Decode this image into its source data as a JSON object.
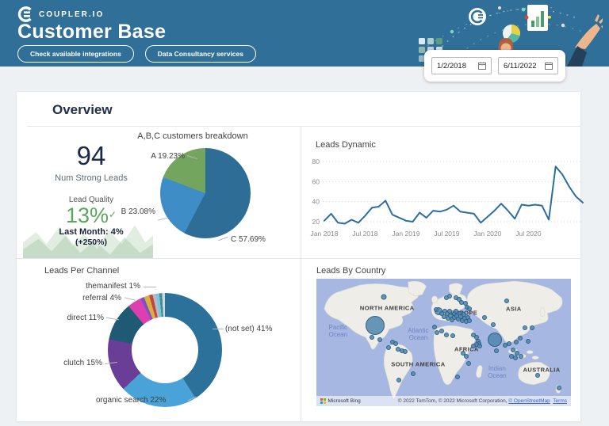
{
  "header": {
    "logo_text": "COUPLER.IO",
    "title": "Customer Base",
    "buttons": [
      {
        "label": "Check available integrations"
      },
      {
        "label": "Data Consultancy services"
      }
    ]
  },
  "date_range": {
    "start": "1/2/2018",
    "end": "6/11/2022"
  },
  "overview": {
    "title": "Overview"
  },
  "kpi": {
    "value": "94",
    "label": "Num Strong Leads",
    "quality_label": "Lead Quality",
    "quality_value": "13%",
    "check": "✓",
    "last_month": "Last Month: 4%",
    "change": "(+250%)"
  },
  "chart_data": [
    {
      "type": "pie",
      "title": "A,B,C customers breakdown",
      "slices": [
        {
          "label": "C",
          "value": 57.69,
          "display": "C 57.69%",
          "color": "#2e6e96"
        },
        {
          "label": "B",
          "value": 23.08,
          "display": "B 23.08%",
          "color": "#3f8dc6"
        },
        {
          "label": "A",
          "value": 19.23,
          "display": "A 19.23%",
          "color": "#73a55f"
        }
      ]
    },
    {
      "type": "line",
      "title": "Leads Dynamic",
      "series_name": "Leads",
      "x_start": "Jan 2018",
      "x_interval": "month",
      "values": [
        21,
        28,
        19,
        18,
        22,
        19,
        26,
        34,
        35,
        41,
        27,
        24,
        21,
        20,
        29,
        24,
        31,
        30,
        32,
        36,
        30,
        29,
        28,
        19,
        25,
        31,
        38,
        31,
        23,
        37,
        36,
        37,
        36,
        22,
        75,
        67,
        55,
        45,
        39
      ],
      "x_ticks": [
        {
          "label": "Jan 2018",
          "index": 0
        },
        {
          "label": "Jul 2018",
          "index": 6
        },
        {
          "label": "Jan 2019",
          "index": 12
        },
        {
          "label": "Jul 2019",
          "index": 18
        },
        {
          "label": "Jan 2020",
          "index": 24
        },
        {
          "label": "Jul 2020",
          "index": 30
        }
      ],
      "y_ticks": [
        20,
        40,
        60,
        80
      ],
      "ylim": [
        15,
        85
      ],
      "line_color": "#2b6f9e",
      "grid": "dotted"
    },
    {
      "type": "donut",
      "title": "Leads Per Channel",
      "slices": [
        {
          "label": "(not set)",
          "value": 41,
          "display": "(not set) 41%",
          "color": "#2b7199"
        },
        {
          "label": "organic search",
          "value": 22,
          "display": "organic search 22%",
          "color": "#4aa3d8"
        },
        {
          "label": "clutch",
          "value": 15,
          "display": "clutch 15%",
          "color": "#6a3d96"
        },
        {
          "label": "direct",
          "value": 11,
          "display": "direct 11%",
          "color": "#1f5a75"
        },
        {
          "label": "referral",
          "value": 4,
          "display": "referral 4%",
          "color": "#dd3fb0"
        },
        {
          "label": "themanifest",
          "value": 1,
          "display": "themanifest 1%",
          "color": "#7a52c9"
        },
        {
          "label": "",
          "value": 1.5,
          "display": "",
          "color": "#d8b13c"
        },
        {
          "label": "",
          "value": 1,
          "display": "",
          "color": "#c44343"
        },
        {
          "label": "",
          "value": 1,
          "display": "",
          "color": "#b3bcc3"
        },
        {
          "label": "",
          "value": 0.9,
          "display": "",
          "color": "#7fc4de"
        },
        {
          "label": "",
          "value": 0.8,
          "display": "",
          "color": "#3f8f93"
        },
        {
          "label": "",
          "value": 0.8,
          "display": "",
          "color": "#cdd9de"
        }
      ]
    },
    {
      "type": "map",
      "title": "Leads By Country",
      "regions": [
        {
          "t": "NORTH AMERICA",
          "x": 27.8,
          "y": 23
        },
        {
          "t": "EUROPE",
          "x": 58,
          "y": 26.5
        },
        {
          "t": "ASIA",
          "x": 77.5,
          "y": 23.5
        },
        {
          "t": "SOUTH AMERICA",
          "x": 40,
          "y": 67
        },
        {
          "t": "AFRICA",
          "x": 59,
          "y": 55
        },
        {
          "t": "AUSTRALIA",
          "x": 88.5,
          "y": 71.5
        }
      ],
      "oceans": [
        {
          "t": "Pacific\nOcean",
          "x": 8.5,
          "y": 41
        },
        {
          "t": "Atlantic\nOcean",
          "x": 40,
          "y": 43.5
        },
        {
          "t": "Indian\nOcean",
          "x": 71,
          "y": 73
        }
      ],
      "points": [
        [
          22.9,
          36.8,
          12
        ],
        [
          26.6,
          14.3,
          3.5
        ],
        [
          21.9,
          45.9,
          3
        ],
        [
          25,
          48,
          3
        ],
        [
          29.9,
          49.5,
          3
        ],
        [
          31.1,
          50.9,
          3
        ],
        [
          32.1,
          55.2,
          3
        ],
        [
          33.5,
          56.4,
          3
        ],
        [
          34.8,
          57.3,
          3
        ],
        [
          28.5,
          54.3,
          3
        ],
        [
          37.9,
          74.3,
          3
        ],
        [
          32.4,
          79.6,
          3
        ],
        [
          51,
          14.7,
          3
        ],
        [
          52.4,
          13.9,
          3
        ],
        [
          54.9,
          14.7,
          3
        ],
        [
          56.1,
          16,
          3
        ],
        [
          57.1,
          18.5,
          3
        ],
        [
          58.6,
          19.4,
          3
        ],
        [
          59.2,
          22.3,
          3
        ],
        [
          60.2,
          23.6,
          3
        ],
        [
          48.1,
          25.7,
          5
        ],
        [
          46.9,
          24.4,
          3
        ],
        [
          49.3,
          27.4,
          3
        ],
        [
          50.6,
          25.3,
          3
        ],
        [
          50.1,
          29.9,
          3
        ],
        [
          51.4,
          27.4,
          3
        ],
        [
          51.6,
          31.2,
          3
        ],
        [
          52.4,
          25.7,
          3
        ],
        [
          52.6,
          29.5,
          3
        ],
        [
          53.2,
          32.4,
          3
        ],
        [
          54.1,
          27.4,
          3
        ],
        [
          54.3,
          30.7,
          3
        ],
        [
          54.9,
          25.3,
          3
        ],
        [
          55.1,
          29.1,
          3
        ],
        [
          55.7,
          31.6,
          3
        ],
        [
          56.3,
          27.4,
          3
        ],
        [
          56.7,
          29.9,
          3
        ],
        [
          57.3,
          32.8,
          3
        ],
        [
          57.9,
          28.2,
          3
        ],
        [
          58.3,
          31.2,
          3
        ],
        [
          59,
          33.7,
          3
        ],
        [
          59.6,
          30.7,
          3
        ],
        [
          60.2,
          32.8,
          3
        ],
        [
          46.5,
          37.9,
          3
        ],
        [
          47.3,
          42.5,
          3
        ],
        [
          49.1,
          41.3,
          3
        ],
        [
          51,
          43.8,
          3
        ],
        [
          53.5,
          44.6,
          3
        ],
        [
          61.8,
          43.8,
          3
        ],
        [
          62.8,
          45.9,
          3
        ],
        [
          63.4,
          48.8,
          3
        ],
        [
          63.8,
          50.9,
          3
        ],
        [
          63,
          51.8,
          3
        ],
        [
          64.2,
          52.6,
          3
        ],
        [
          61.6,
          52.6,
          3
        ],
        [
          66.1,
          30.7,
          3
        ],
        [
          69.4,
          36.2,
          3
        ],
        [
          70,
          48,
          9
        ],
        [
          74.7,
          17.3,
          3
        ],
        [
          81.9,
          38.3,
          3
        ],
        [
          84.7,
          38.7,
          3
        ],
        [
          80.2,
          46.3,
          3
        ],
        [
          83.1,
          48.8,
          3
        ],
        [
          78.6,
          49.7,
          3
        ],
        [
          75.7,
          50.9,
          3
        ],
        [
          74.1,
          52.2,
          3
        ],
        [
          77.2,
          56,
          3
        ],
        [
          78.8,
          58.1,
          3
        ],
        [
          76.6,
          60.6,
          3
        ],
        [
          78.2,
          62.3,
          3
        ],
        [
          80.4,
          60.6,
          3
        ],
        [
          70.8,
          56.8,
          3
        ],
        [
          57.5,
          58.5,
          3
        ],
        [
          59,
          61,
          3
        ],
        [
          59.8,
          66.3,
          3
        ],
        [
          55.4,
          77,
          3
        ],
        [
          87,
          76,
          3
        ],
        [
          95.2,
          85.5,
          3
        ]
      ],
      "attribution": "© 2022 TomTom, © 2022 Microsoft Corporation,",
      "attribution_link": "© OpenStreetMap",
      "terms": "Terms",
      "provider": "Microsoft Bing"
    }
  ]
}
